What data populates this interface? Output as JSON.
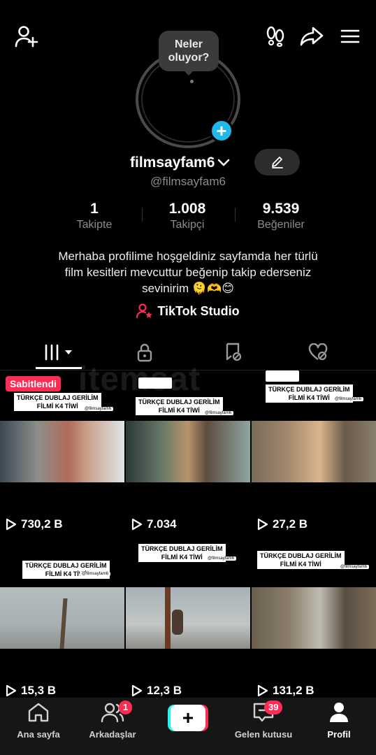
{
  "header": {
    "icons": [
      "add-friend-icon",
      "footsteps-icon",
      "share-icon",
      "menu-icon"
    ]
  },
  "profile": {
    "note_bubble": "Neler oluyor?",
    "username": "filmsayfam6",
    "handle": "@filmsayfam6",
    "stats": [
      {
        "value": "1",
        "label": "Takipte"
      },
      {
        "value": "1.008",
        "label": "Takipçi"
      },
      {
        "value": "9.539",
        "label": "Beğeniler"
      }
    ],
    "bio_line1": "Merhaba profilime hoşgeldiniz sayfamda her türlü",
    "bio_line2": "film kesitleri mevcuttur beğenip takip ederseniz",
    "bio_line3": "sevinirim 🫠🫶😊",
    "studio_link": "TikTok Studio"
  },
  "watermark": "itemsat",
  "tabs": [
    "videos-grid-icon",
    "lock-icon",
    "reposts-icon",
    "liked-icon"
  ],
  "videos": [
    {
      "pinned": "Sabitlendi",
      "caption1": "TÜRKÇE DUBLAJ GERİLİM",
      "caption2": "FİLMİ K4 TİWİ",
      "tag": "@filmsayfam6",
      "views": "730,2 B"
    },
    {
      "caption1": "TÜRKÇE DUBLAJ GERİLİM",
      "caption2": "FİLMİ K4 TİWİ",
      "tag": "@filmsayfam6",
      "views": "7.034"
    },
    {
      "caption1": "TÜRKÇE DUBLAJ GERİLİM",
      "caption2": "FİLMİ K4 TİWİ",
      "tag": "@filmsayfam6",
      "views": "27,2 B"
    },
    {
      "caption1": "TÜRKÇE DUBLAJ GERİLİM",
      "caption2": "FİLMİ K4 TİWİ",
      "tag": "@filmsayfam6",
      "views": "15,3 B"
    },
    {
      "caption1": "TÜRKÇE DUBLAJ GERİLİM",
      "caption2": "FİLMİ K4 TİWİ",
      "tag": "@filmsayfam6",
      "views": "12,3 B"
    },
    {
      "caption1": "TÜRKÇE DUBLAJ GERİLİM",
      "caption2": "FİLMİ K4 TİWİ",
      "tag": "@filmsayfam6",
      "views": "131,2 B"
    }
  ],
  "nav": {
    "home": "Ana sayfa",
    "friends": "Arkadaşlar",
    "friends_badge": "1",
    "create": "+",
    "inbox": "Gelen kutusu",
    "inbox_badge": "39",
    "profile": "Profil"
  },
  "colors": {
    "accent": "#fe2c55",
    "cyan": "#25f4ee",
    "plus_badge": "#20b8e8"
  }
}
